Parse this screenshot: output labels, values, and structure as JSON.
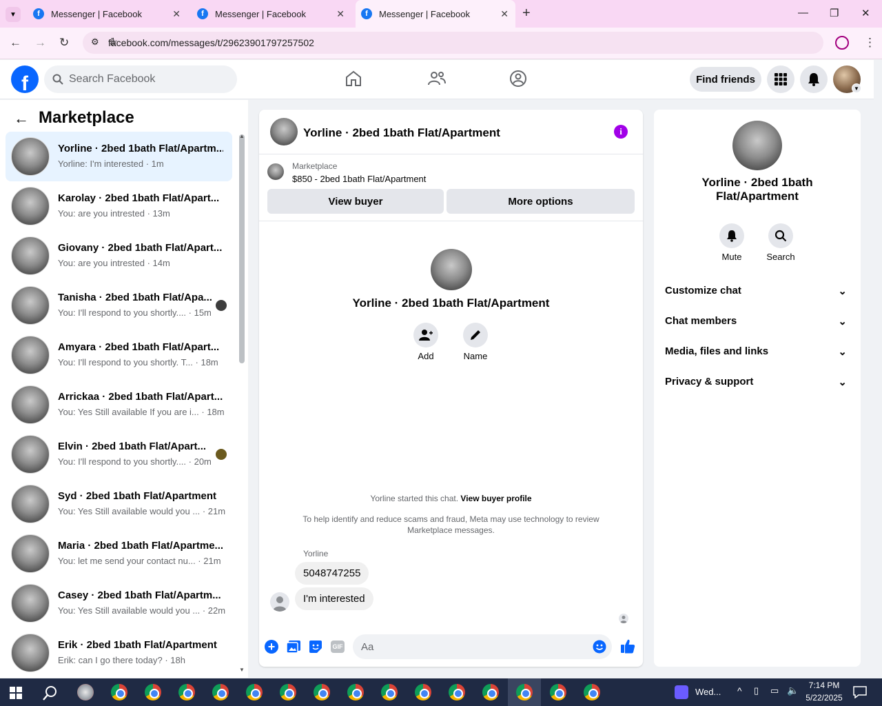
{
  "browser": {
    "tabs": [
      {
        "title": "Messenger | Facebook"
      },
      {
        "title": "Messenger | Facebook"
      },
      {
        "title": "Messenger | Facebook"
      }
    ],
    "url": "facebook.com/messages/t/29623901797257502"
  },
  "header": {
    "search_placeholder": "Search Facebook",
    "find_friends": "Find friends"
  },
  "sidebar": {
    "title": "Marketplace",
    "conversations": [
      {
        "name": "Yorline · 2bed 1bath Flat/Apartm...",
        "preview": "Yorline: I'm interested · 1m"
      },
      {
        "name": "Karolay · 2bed 1bath Flat/Apart...",
        "preview": "You: are you intrested · 13m"
      },
      {
        "name": "Giovany · 2bed 1bath Flat/Apart...",
        "preview": "You: are you intrested · 14m"
      },
      {
        "name": "Tanisha · 2bed 1bath Flat/Apa...",
        "preview": "You: I'll respond to you shortly.... · 15m"
      },
      {
        "name": "Amyara · 2bed 1bath Flat/Apart...",
        "preview": "You: I'll respond to you shortly. T... · 18m"
      },
      {
        "name": "Arrickaa · 2bed 1bath Flat/Apart...",
        "preview": "You: Yes Still available If you are i... · 18m"
      },
      {
        "name": "Elvin · 2bed 1bath Flat/Apart...",
        "preview": "You: I'll respond to you shortly.... · 20m"
      },
      {
        "name": "Syd · 2bed 1bath Flat/Apartment",
        "preview": "You: Yes Still available would you ... · 21m"
      },
      {
        "name": "Maria · 2bed 1bath Flat/Apartme...",
        "preview": "You: let me send your contact nu... · 21m"
      },
      {
        "name": "Casey · 2bed 1bath Flat/Apartm...",
        "preview": "You: Yes Still available would you ... · 22m"
      },
      {
        "name": "Erik · 2bed 1bath Flat/Apartment",
        "preview": "Erik: can I go there today? · 18h"
      }
    ]
  },
  "chat": {
    "title": "Yorline · 2bed 1bath Flat/Apartment",
    "listing_source": "Marketplace",
    "listing": "$850 - 2bed 1bath Flat/Apartment",
    "view_buyer": "View buyer",
    "more_options": "More options",
    "center_name": "Yorline · 2bed 1bath Flat/Apartment",
    "add_label": "Add",
    "name_label": "Name",
    "started_text": "Yorline started this chat.",
    "view_buyer_profile": "View buyer profile",
    "notice": "To help identify and reduce scams and fraud, Meta may use technology to review Marketplace messages.",
    "sender": "Yorline",
    "messages": [
      "5048747255",
      "I'm interested"
    ],
    "composer_placeholder": "Aa",
    "gif_label": "GIF"
  },
  "info_panel": {
    "name": "Yorline · 2bed 1bath Flat/Apartment",
    "mute": "Mute",
    "search": "Search",
    "sections": [
      "Customize chat",
      "Chat members",
      "Media, files and links",
      "Privacy & support"
    ]
  },
  "taskbar": {
    "time": "7:14 PM",
    "date": "5/22/2025",
    "weather": "Wed..."
  },
  "colors": {
    "accent": "#0866ff",
    "purple_info": "#a100e8",
    "tabbar": "#f9d8f4"
  }
}
